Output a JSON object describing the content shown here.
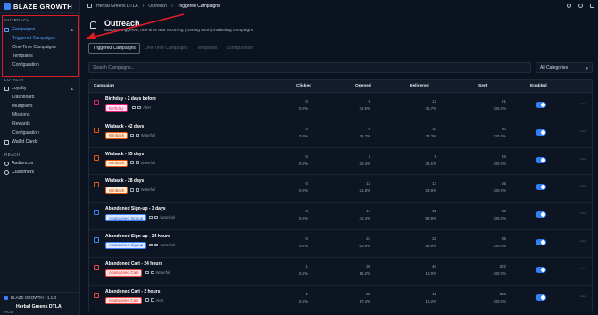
{
  "app": {
    "brand": "BLAZE GROWTH",
    "version": "BLAZE GROWTH - 1.1.0",
    "store_name": "Herbal Greens DTLA",
    "store_abbr": "HGD"
  },
  "sidebar": {
    "outreach_label": "OUTREACH",
    "campaigns_label": "Campaigns",
    "campaign_subitems": [
      "Triggered Campaigns",
      "One-Time Campaigns",
      "Templates",
      "Configuration"
    ],
    "loyalty_section": "LOYALTY",
    "loyalty_label": "Loyalty",
    "loyalty_subitems": [
      "Dashboard",
      "Multipliers",
      "Missions",
      "Rewards",
      "Configuration"
    ],
    "wallet_label": "Wallet Cards",
    "reach_section": "REACH",
    "audiences_label": "Audiences",
    "customers_label": "Customers"
  },
  "breadcrumb": {
    "items": [
      "Herbal Greens DTLA",
      "Outreach",
      "Triggered Campaigns"
    ]
  },
  "header": {
    "title": "Outreach",
    "subtitle": "Manage triggered, one-time and recurring (coming soon) marketing campaigns"
  },
  "tabs": [
    "Triggered Campaigns",
    "One-Time Campaigns",
    "Templates",
    "Configuration"
  ],
  "search": {
    "placeholder": "Search Campaigns..."
  },
  "category": {
    "selected": "All Categories"
  },
  "table": {
    "columns": [
      "Campaign",
      "Clicked",
      "Opened",
      "Delivered",
      "Sent",
      "Enabled"
    ],
    "rows": [
      {
        "name": "Birthday - 2 days before",
        "badge": "Birthday",
        "badge_style": "pink",
        "meta": "Alert",
        "icon_color": "#e11d74",
        "clicked": [
          "0",
          "0.0%"
        ],
        "opened": [
          "9",
          "42.9%"
        ],
        "delivered": [
          "13",
          "46.7%"
        ],
        "sent": [
          "21",
          "100.0%"
        ],
        "enabled": true
      },
      {
        "name": "Winback - 42 days",
        "badge": "Winback",
        "badge_style": "orange",
        "meta": "Waterfall",
        "icon_color": "#ea580c",
        "clicked": [
          "0",
          "0.0%"
        ],
        "opened": [
          "8",
          "26.7%"
        ],
        "delivered": [
          "10",
          "33.3%"
        ],
        "sent": [
          "30",
          "100.0%"
        ],
        "enabled": true
      },
      {
        "name": "Winback - 35 days",
        "badge": "Winback",
        "badge_style": "orange",
        "meta": "Waterfall",
        "icon_color": "#ea580c",
        "clicked": [
          "0",
          "0.0%"
        ],
        "opened": [
          "7",
          "30.4%"
        ],
        "delivered": [
          "9",
          "39.1%"
        ],
        "sent": [
          "23",
          "100.0%"
        ],
        "enabled": true
      },
      {
        "name": "Winback - 28 days",
        "badge": "Winback",
        "badge_style": "orange",
        "meta": "Waterfall",
        "icon_color": "#ea580c",
        "clicked": [
          "0",
          "0.0%"
        ],
        "opened": [
          "12",
          "21.8%"
        ],
        "delivered": [
          "13",
          "23.6%"
        ],
        "sent": [
          "55",
          "100.0%"
        ],
        "enabled": true
      },
      {
        "name": "Abandoned Sign-up - 3 days",
        "badge": "Abandoned Signup",
        "badge_style": "blue",
        "meta": "Waterfall",
        "icon_color": "#3b82f6",
        "clicked": [
          "0",
          "0.0%"
        ],
        "opened": [
          "14",
          "42.4%"
        ],
        "delivered": [
          "31",
          "93.9%"
        ],
        "sent": [
          "33",
          "100.0%"
        ],
        "enabled": true
      },
      {
        "name": "Abandoned Sign-up - 24 hours",
        "badge": "Abandoned Signup",
        "badge_style": "blue",
        "meta": "Waterfall",
        "icon_color": "#3b82f6",
        "clicked": [
          "0",
          "0.0%"
        ],
        "opened": [
          "23",
          "63.9%"
        ],
        "delivered": [
          "32",
          "88.9%"
        ],
        "sent": [
          "36",
          "100.0%"
        ],
        "enabled": true
      },
      {
        "name": "Abandoned Cart - 24 hours",
        "badge": "Abandoned Cart",
        "badge_style": "red",
        "meta": "Waterfall",
        "icon_color": "#ef4444",
        "clicked": [
          "1",
          "0.4%"
        ],
        "opened": [
          "36",
          "16.2%"
        ],
        "delivered": [
          "40",
          "18.0%"
        ],
        "sent": [
          "222",
          "100.0%"
        ],
        "enabled": true
      },
      {
        "name": "Abandoned Cart - 2 hours",
        "badge": "Abandoned Cart",
        "badge_style": "red",
        "meta": "Alert",
        "icon_color": "#ef4444",
        "clicked": [
          "1",
          "0.5%"
        ],
        "opened": [
          "38",
          "17.4%"
        ],
        "delivered": [
          "42",
          "19.2%"
        ],
        "sent": [
          "219",
          "100.0%"
        ],
        "enabled": true
      }
    ]
  }
}
